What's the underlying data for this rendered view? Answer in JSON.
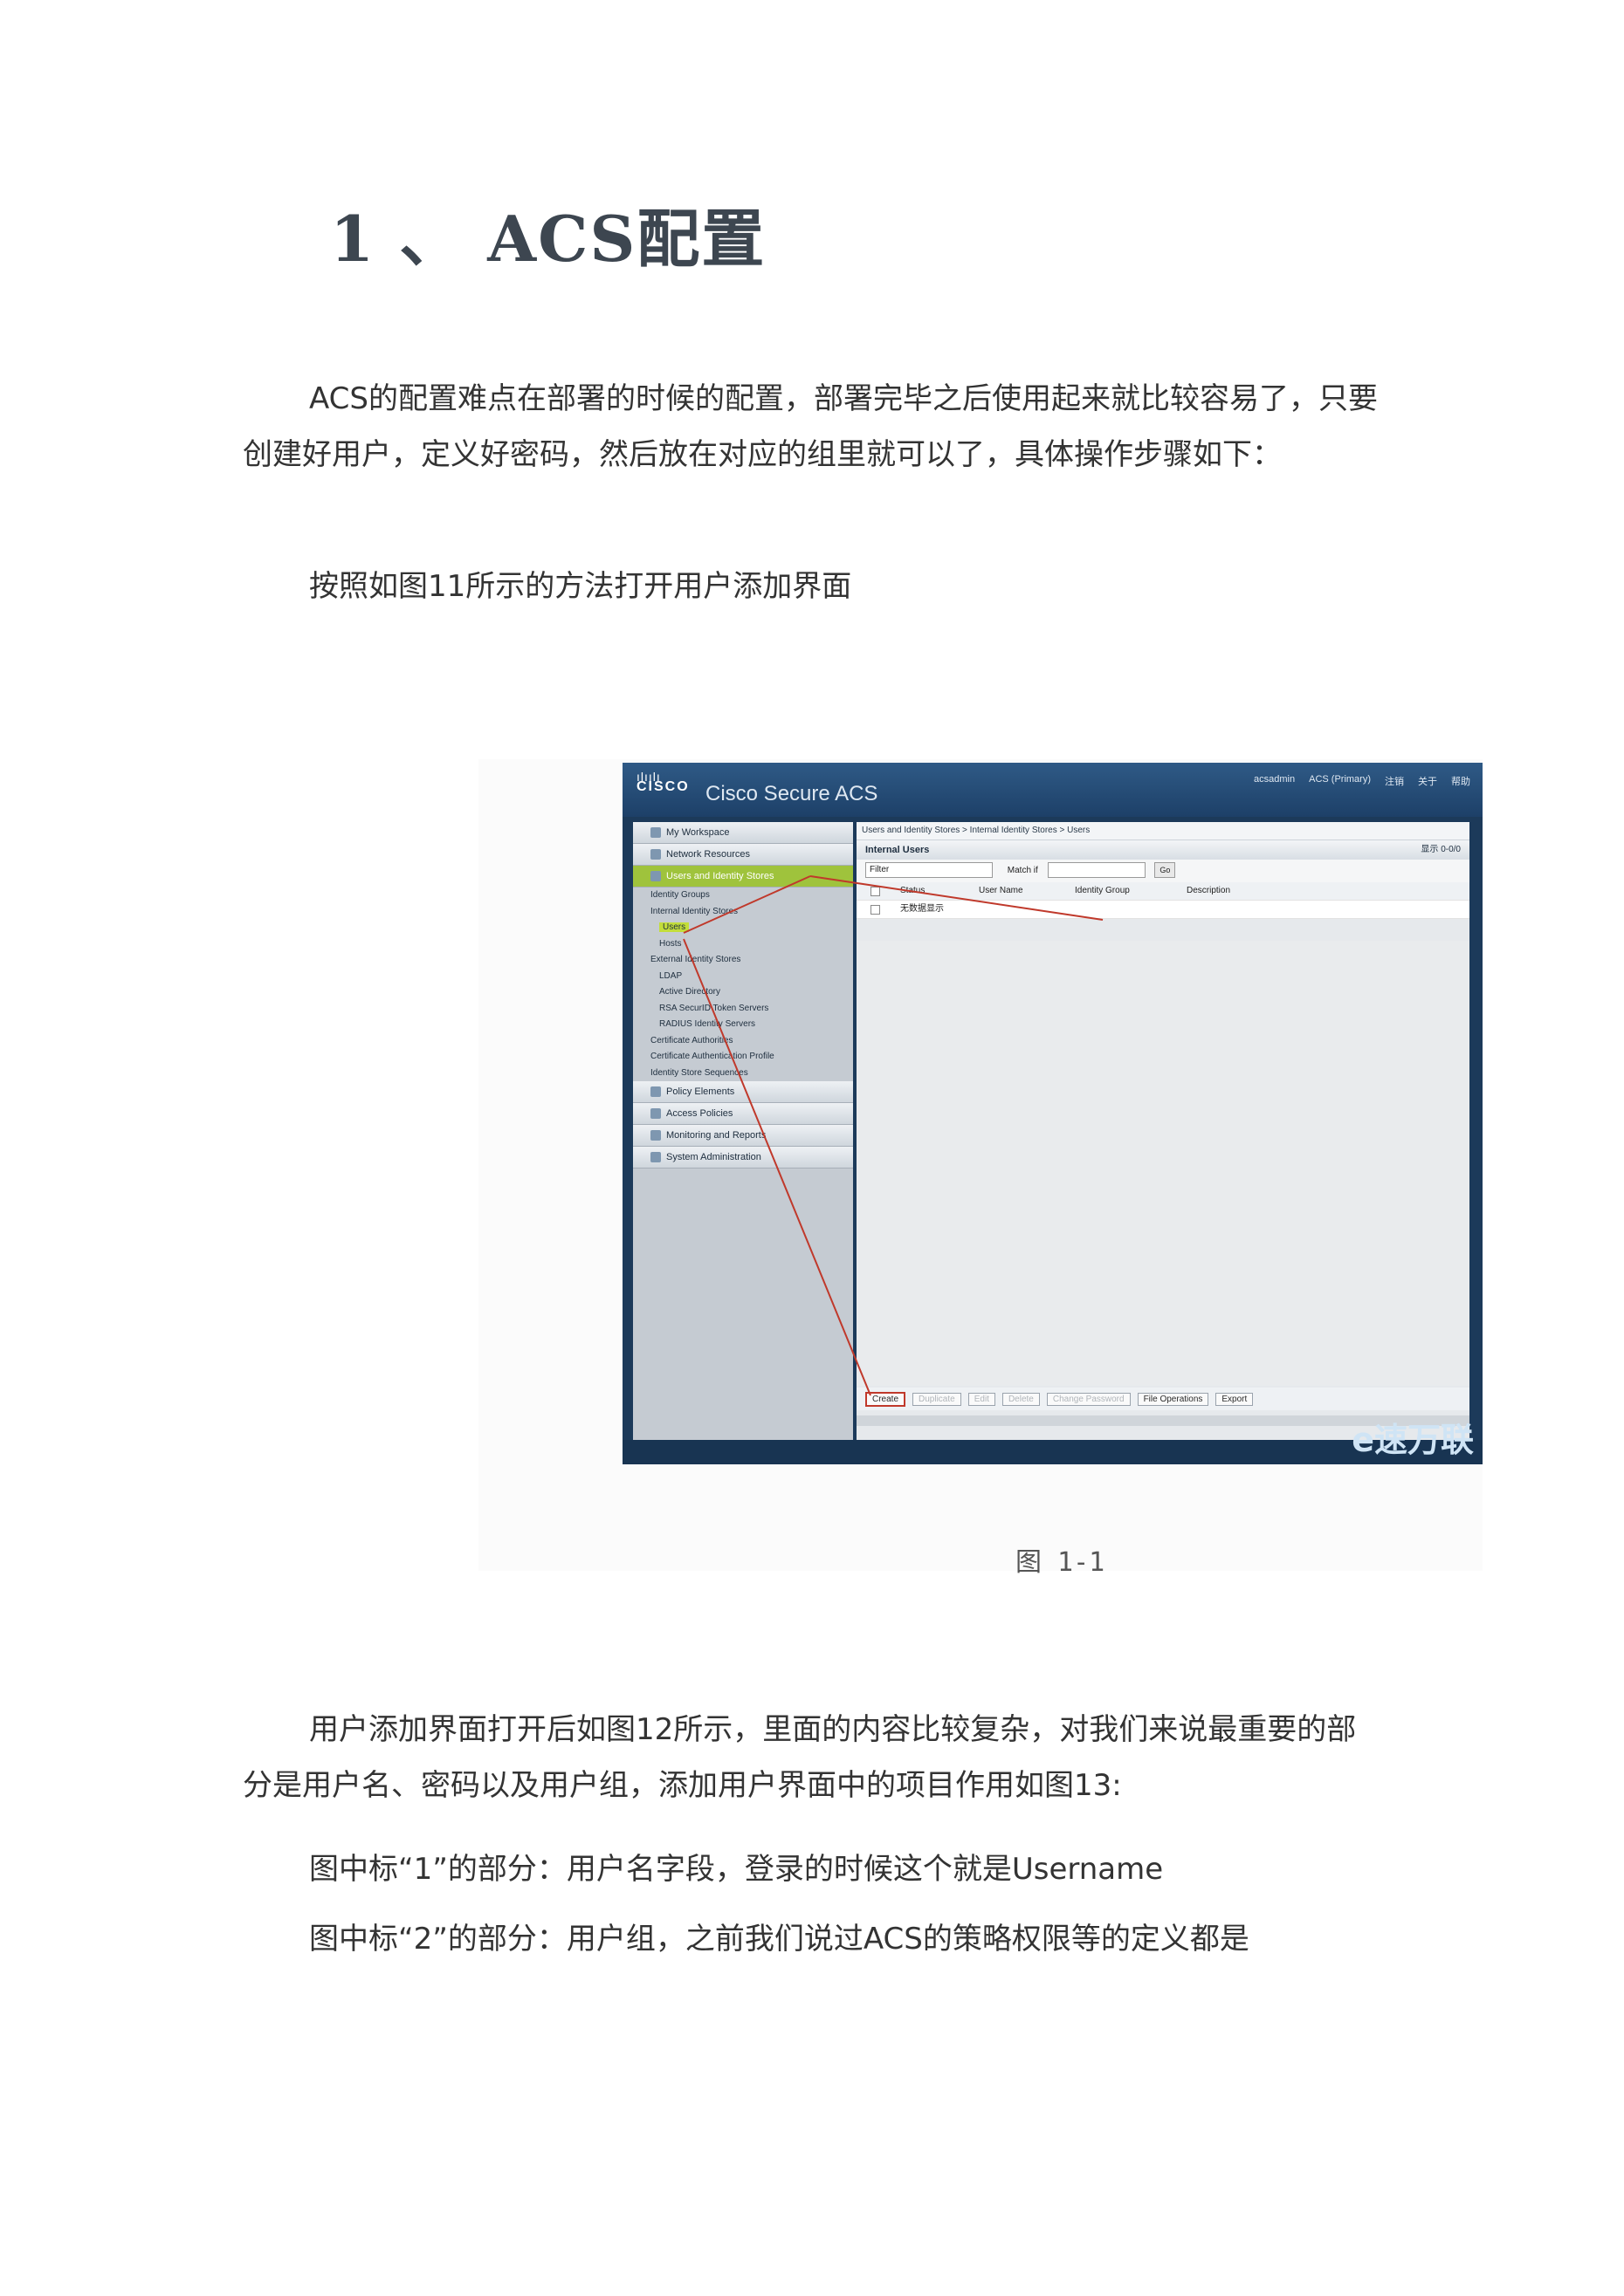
{
  "heading": "1 、 ACS配置",
  "paragraphs": {
    "p1": "ACS的配置难点在部署的时候的配置，部署完毕之后使用起来就比较容易了，只要创建好用户，定义好密码，然后放在对应的组里就可以了，具体操作步骤如下：",
    "p2": "按照如图11所示的方法打开用户添加界面",
    "p3": "用户添加界面打开后如图12所示，里面的内容比较复杂，对我们来说最重要的部分是用户名、密码以及用户组，添加用户界面中的项目作用如图13:",
    "p4": "图中标“1”的部分：用户名字段，登录的时候这个就是Username",
    "p5": "图中标“2”的部分：用户组，之前我们说过ACS的策略权限等的定义都是"
  },
  "figure": {
    "caption": "图 1-1",
    "app_title": "Cisco Secure ACS",
    "logo_text": "CISCO",
    "top_right": [
      "acsadmin",
      "ACS (Primary)",
      "注销",
      "关于",
      "帮助"
    ],
    "nav": [
      {
        "label": "My Workspace",
        "active": false
      },
      {
        "label": "Network Resources",
        "active": false
      },
      {
        "label": "Users and Identity Stores",
        "active": true
      }
    ],
    "subitems": [
      {
        "label": "Identity Groups",
        "level": 1,
        "highlight": false
      },
      {
        "label": "Internal Identity Stores",
        "level": 1,
        "highlight": false
      },
      {
        "label": "Users",
        "level": 2,
        "highlight": true
      },
      {
        "label": "Hosts",
        "level": 2,
        "highlight": false
      },
      {
        "label": "External Identity Stores",
        "level": 1,
        "highlight": false
      },
      {
        "label": "LDAP",
        "level": 2,
        "highlight": false
      },
      {
        "label": "Active Directory",
        "level": 2,
        "highlight": false
      },
      {
        "label": "RSA SecurID Token Servers",
        "level": 2,
        "highlight": false
      },
      {
        "label": "RADIUS Identity Servers",
        "level": 2,
        "highlight": false
      },
      {
        "label": "Certificate Authorities",
        "level": 1,
        "highlight": false
      },
      {
        "label": "Certificate Authentication Profile",
        "level": 1,
        "highlight": false
      },
      {
        "label": "Identity Store Sequences",
        "level": 1,
        "highlight": false
      }
    ],
    "nav_bottom": [
      {
        "label": "Policy Elements"
      },
      {
        "label": "Access Policies"
      },
      {
        "label": "Monitoring and Reports"
      },
      {
        "label": "System Administration"
      }
    ],
    "breadcrumb": "Users and Identity Stores > Internal Identity Stores > Users",
    "box_title": "Internal Users",
    "pager": "显示 0-0/0",
    "filter_label": "Filter",
    "match_label": "Match if",
    "go_label": "Go",
    "columns": [
      "Status",
      "User Name",
      "Identity Group",
      "Description"
    ],
    "empty_row": "无数据显示",
    "buttons": [
      "Create",
      "Duplicate",
      "Edit",
      "Delete",
      "Change Password",
      "File Operations",
      "Export"
    ],
    "watermark": "e速万联"
  }
}
